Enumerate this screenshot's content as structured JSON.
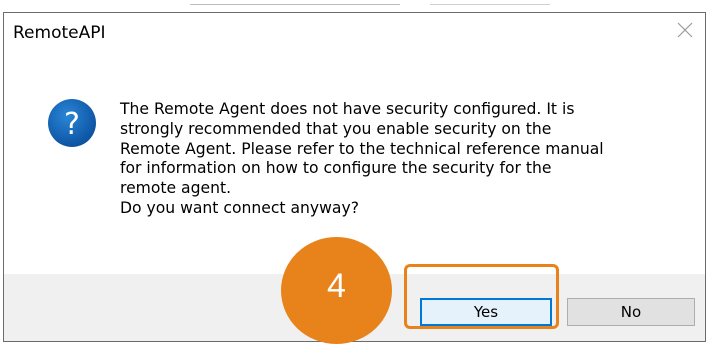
{
  "dialog": {
    "title": "RemoteAPI",
    "close_icon": "close-icon",
    "icon": "question-icon",
    "icon_glyph": "?",
    "message_lines": [
      "The Remote Agent does not have security configured. It is",
      "strongly recommended that you enable security on the",
      "Remote Agent. Please refer to the technical reference manual",
      "for information on how to configure the security for the",
      "remote agent.",
      "Do you want connect anyway?"
    ],
    "buttons": {
      "yes_label": "Yes",
      "no_label": "No"
    }
  },
  "annotation": {
    "step_number": "4",
    "highlight_color": "#e8821a"
  },
  "colors": {
    "icon_blue": "#0a63b8",
    "focus_blue": "#0078d7",
    "footer_bg": "#f0f0f0"
  }
}
